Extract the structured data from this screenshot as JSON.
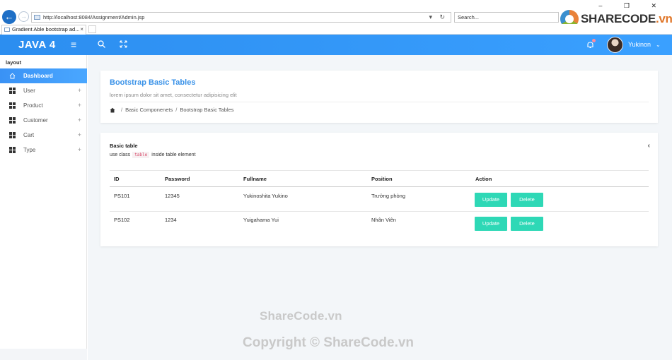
{
  "browser": {
    "url": "http://localhost:8084/Assignment/Admin.jsp",
    "search_placeholder": "Search...",
    "tab_title": "Gradient Able bootstrap ad...",
    "tab_close": "×",
    "window_controls": "‒ ❐ ✕",
    "address_tools": "▾ ↻"
  },
  "watermark": {
    "logo_main": "SHARECODE",
    "logo_suffix": ".vn",
    "center_text": "ShareCode.vn",
    "copyright": "Copyright © ShareCode.vn"
  },
  "header": {
    "brand": "JAVA 4",
    "menu_glyph": "≡",
    "user_name": "Yukinon",
    "user_chevron": "⌄"
  },
  "sidebar": {
    "caption": "layout",
    "items": [
      {
        "label": "Dashboard",
        "icon": "home-icon",
        "active": true
      },
      {
        "label": "User",
        "icon": "grid-icon",
        "expand": "+"
      },
      {
        "label": "Product",
        "icon": "grid-icon",
        "expand": "+"
      },
      {
        "label": "Customer",
        "icon": "grid-icon",
        "expand": "+"
      },
      {
        "label": "Cart",
        "icon": "grid-icon",
        "expand": "+"
      },
      {
        "label": "Type",
        "icon": "grid-icon",
        "expand": "+"
      }
    ]
  },
  "page": {
    "title": "Bootstrap Basic Tables",
    "subtitle": "lorem ipsum dolor sit amet, consectetur adipisicing elit",
    "breadcrumb": [
      "Basic Componenets",
      "Bootstrap Basic Tables"
    ],
    "separator": "/"
  },
  "table_card": {
    "title": "Basic table",
    "desc_before": "use class",
    "desc_code": "table",
    "desc_after": "inside table element",
    "collapse_glyph": "‹",
    "columns": [
      "ID",
      "Password",
      "Fullname",
      "Position",
      "Action"
    ],
    "rows": [
      {
        "id": "PS101",
        "password": "12345",
        "fullname": "Yukinoshita Yukino",
        "position": "Trưởng phòng",
        "update": "Update",
        "delete": "Delete"
      },
      {
        "id": "PS102",
        "password": "1234",
        "fullname": "Yuigahama Yui",
        "position": "Nhân Viên",
        "update": "Update",
        "delete": "Delete"
      }
    ]
  },
  "colors": {
    "header_gradient_start": "#2c8ef0",
    "header_gradient_end": "#3aa0ff",
    "title_blue": "#3a92e8",
    "button_teal": "#2ed8b6",
    "code_pink": "#d94a6a"
  }
}
